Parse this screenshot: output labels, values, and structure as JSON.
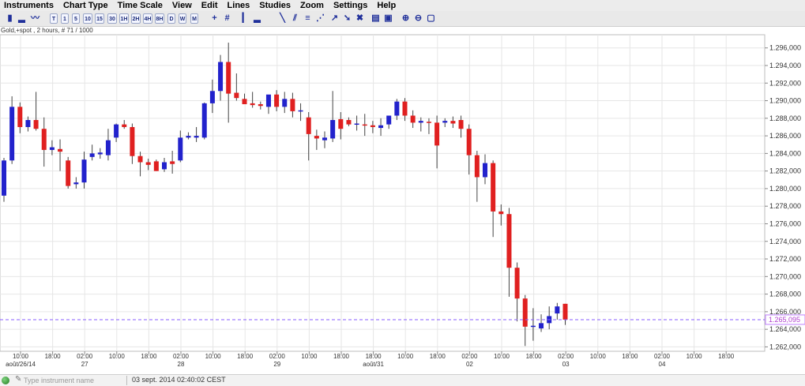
{
  "menu": [
    "Instruments",
    "Chart Type",
    "Time Scale",
    "View",
    "Edit",
    "Lines",
    "Studies",
    "Zoom",
    "Settings",
    "Help"
  ],
  "toolbar": {
    "timeframes": [
      "T",
      "1",
      "5",
      "10",
      "15",
      "30",
      "1H",
      "2H",
      "4H",
      "8H",
      "D",
      "W",
      "M"
    ],
    "selected_timeframe": "2H",
    "icons": [
      "crosshair-icon",
      "grid-icon",
      "candlestick-icon",
      "line-chart-icon",
      "vertical-line-icon",
      "bar-study-icon",
      "trend-line-icon",
      "parallel-line-icon",
      "fibonacci-icon",
      "channel-icon",
      "arrow-tool-icon",
      "pointer-tool-icon",
      "delete-tool-icon",
      "print-icon",
      "save-icon",
      "zoom-in-icon",
      "zoom-out-icon",
      "zoom-reset-icon"
    ]
  },
  "info": "Gold,+spot , 2 hours, # 71 / 1000",
  "status": {
    "search_placeholder": "Type instrument name",
    "datetime": "03 sept. 2014 02:40:02 CEST"
  },
  "chart_data": {
    "type": "candlestick",
    "ylim": [
      1261500,
      1297500
    ],
    "yticks": [
      "1.262,000",
      "1.264,000",
      "1.266,000",
      "1.268,000",
      "1.270,000",
      "1.272,000",
      "1.274,000",
      "1.276,000",
      "1.278,000",
      "1.280,000",
      "1.282,000",
      "1.284,000",
      "1.286,000",
      "1.288,000",
      "1.290,000",
      "1.292,000",
      "1.294,000",
      "1.296,000"
    ],
    "ytick_values": [
      1262000,
      1264000,
      1266000,
      1268000,
      1270000,
      1272000,
      1274000,
      1276000,
      1278000,
      1280000,
      1282000,
      1284000,
      1286000,
      1288000,
      1290000,
      1292000,
      1294000,
      1296000
    ],
    "last_price_label": "1.265,095",
    "last_price": 1265095,
    "up_color": "#2222cc",
    "down_color": "#e02020",
    "grid": true,
    "xticks": [
      {
        "time": "10:00",
        "date": "août/26/14"
      },
      {
        "time": "18:00",
        "date": ""
      },
      {
        "time": "02:00",
        "date": "27"
      },
      {
        "time": "10:00",
        "date": ""
      },
      {
        "time": "18:00",
        "date": ""
      },
      {
        "time": "02:00",
        "date": "28"
      },
      {
        "time": "10:00",
        "date": ""
      },
      {
        "time": "18:00",
        "date": ""
      },
      {
        "time": "02:00",
        "date": "29"
      },
      {
        "time": "10:00",
        "date": ""
      },
      {
        "time": "18:00",
        "date": ""
      },
      {
        "time": "18:00",
        "date": "août/31"
      },
      {
        "time": "10:00",
        "date": ""
      },
      {
        "time": "18:00",
        "date": ""
      },
      {
        "time": "02:00",
        "date": "02"
      },
      {
        "time": "10:00",
        "date": ""
      },
      {
        "time": "18:00",
        "date": ""
      },
      {
        "time": "02:00",
        "date": "03"
      },
      {
        "time": "10:00",
        "date": ""
      },
      {
        "time": "18:00",
        "date": ""
      },
      {
        "time": "02:00",
        "date": "04"
      },
      {
        "time": "10:00",
        "date": ""
      },
      {
        "time": "18:00",
        "date": ""
      }
    ],
    "candles": [
      {
        "o": 1279200,
        "h": 1283500,
        "l": 1278500,
        "c": 1283200
      },
      {
        "o": 1283200,
        "h": 1290500,
        "l": 1282800,
        "c": 1289300
      },
      {
        "o": 1289300,
        "h": 1289800,
        "l": 1286300,
        "c": 1287000
      },
      {
        "o": 1287000,
        "h": 1288200,
        "l": 1286500,
        "c": 1287800
      },
      {
        "o": 1287800,
        "h": 1291000,
        "l": 1286600,
        "c": 1286800
      },
      {
        "o": 1286800,
        "h": 1288100,
        "l": 1282500,
        "c": 1284400
      },
      {
        "o": 1284400,
        "h": 1285500,
        "l": 1283800,
        "c": 1284700
      },
      {
        "o": 1284500,
        "h": 1285600,
        "l": 1282000,
        "c": 1284200
      },
      {
        "o": 1283200,
        "h": 1283600,
        "l": 1280000,
        "c": 1280300
      },
      {
        "o": 1280500,
        "h": 1281300,
        "l": 1280000,
        "c": 1280700
      },
      {
        "o": 1280700,
        "h": 1284200,
        "l": 1280000,
        "c": 1283300
      },
      {
        "o": 1283600,
        "h": 1285000,
        "l": 1283200,
        "c": 1284000
      },
      {
        "o": 1283900,
        "h": 1284600,
        "l": 1283400,
        "c": 1284100
      },
      {
        "o": 1283800,
        "h": 1286800,
        "l": 1283200,
        "c": 1285500
      },
      {
        "o": 1285800,
        "h": 1287400,
        "l": 1285300,
        "c": 1287300
      },
      {
        "o": 1287300,
        "h": 1287800,
        "l": 1286800,
        "c": 1287000
      },
      {
        "o": 1287000,
        "h": 1287400,
        "l": 1282800,
        "c": 1283700
      },
      {
        "o": 1283700,
        "h": 1284200,
        "l": 1281400,
        "c": 1283000
      },
      {
        "o": 1283000,
        "h": 1283400,
        "l": 1282100,
        "c": 1282700
      },
      {
        "o": 1283100,
        "h": 1283300,
        "l": 1282000,
        "c": 1282000
      },
      {
        "o": 1282200,
        "h": 1283500,
        "l": 1281900,
        "c": 1283000
      },
      {
        "o": 1283100,
        "h": 1284300,
        "l": 1281700,
        "c": 1282800
      },
      {
        "o": 1283200,
        "h": 1286600,
        "l": 1283000,
        "c": 1285800
      },
      {
        "o": 1285800,
        "h": 1286400,
        "l": 1285600,
        "c": 1286000
      },
      {
        "o": 1285800,
        "h": 1287000,
        "l": 1285300,
        "c": 1286000
      },
      {
        "o": 1285800,
        "h": 1289800,
        "l": 1285600,
        "c": 1289700
      },
      {
        "o": 1289700,
        "h": 1292400,
        "l": 1288600,
        "c": 1291100
      },
      {
        "o": 1291100,
        "h": 1295200,
        "l": 1290000,
        "c": 1294400
      },
      {
        "o": 1294400,
        "h": 1296600,
        "l": 1287500,
        "c": 1290800
      },
      {
        "o": 1290900,
        "h": 1293100,
        "l": 1290000,
        "c": 1290300
      },
      {
        "o": 1290200,
        "h": 1290800,
        "l": 1289600,
        "c": 1289600
      },
      {
        "o": 1289700,
        "h": 1291000,
        "l": 1289200,
        "c": 1289500
      },
      {
        "o": 1289600,
        "h": 1289900,
        "l": 1289000,
        "c": 1289400
      },
      {
        "o": 1289300,
        "h": 1290600,
        "l": 1288500,
        "c": 1290700
      },
      {
        "o": 1290700,
        "h": 1291200,
        "l": 1288800,
        "c": 1289300
      },
      {
        "o": 1289300,
        "h": 1291000,
        "l": 1288600,
        "c": 1290200
      },
      {
        "o": 1290200,
        "h": 1290900,
        "l": 1288100,
        "c": 1288800
      },
      {
        "o": 1288800,
        "h": 1289700,
        "l": 1287700,
        "c": 1288900
      },
      {
        "o": 1288100,
        "h": 1288700,
        "l": 1283200,
        "c": 1286200
      },
      {
        "o": 1286000,
        "h": 1286700,
        "l": 1284400,
        "c": 1285700
      },
      {
        "o": 1285500,
        "h": 1286500,
        "l": 1284600,
        "c": 1285800
      },
      {
        "o": 1285700,
        "h": 1291100,
        "l": 1285300,
        "c": 1287800
      },
      {
        "o": 1287900,
        "h": 1288700,
        "l": 1285600,
        "c": 1286800
      },
      {
        "o": 1287800,
        "h": 1288100,
        "l": 1287100,
        "c": 1287300
      },
      {
        "o": 1287400,
        "h": 1288300,
        "l": 1286600,
        "c": 1287400
      },
      {
        "o": 1287300,
        "h": 1288500,
        "l": 1286000,
        "c": 1287200
      },
      {
        "o": 1287200,
        "h": 1287700,
        "l": 1286300,
        "c": 1287000
      },
      {
        "o": 1286900,
        "h": 1288000,
        "l": 1286000,
        "c": 1287200
      },
      {
        "o": 1287300,
        "h": 1288300,
        "l": 1286800,
        "c": 1288300
      },
      {
        "o": 1288300,
        "h": 1290200,
        "l": 1287800,
        "c": 1289900
      },
      {
        "o": 1289900,
        "h": 1290300,
        "l": 1287700,
        "c": 1288300
      },
      {
        "o": 1288300,
        "h": 1288900,
        "l": 1286900,
        "c": 1287500
      },
      {
        "o": 1287500,
        "h": 1288100,
        "l": 1286500,
        "c": 1287700
      },
      {
        "o": 1287600,
        "h": 1288000,
        "l": 1286200,
        "c": 1287500
      },
      {
        "o": 1287500,
        "h": 1288300,
        "l": 1282300,
        "c": 1284900
      },
      {
        "o": 1287500,
        "h": 1288000,
        "l": 1287000,
        "c": 1287700
      },
      {
        "o": 1287700,
        "h": 1288200,
        "l": 1286900,
        "c": 1287400
      },
      {
        "o": 1287800,
        "h": 1288300,
        "l": 1285800,
        "c": 1286800
      },
      {
        "o": 1286800,
        "h": 1287300,
        "l": 1281600,
        "c": 1283800
      },
      {
        "o": 1283800,
        "h": 1284300,
        "l": 1278500,
        "c": 1281300
      },
      {
        "o": 1281300,
        "h": 1283900,
        "l": 1280500,
        "c": 1282900
      },
      {
        "o": 1282900,
        "h": 1283200,
        "l": 1274500,
        "c": 1277400
      },
      {
        "o": 1277400,
        "h": 1278200,
        "l": 1275800,
        "c": 1277100
      },
      {
        "o": 1277100,
        "h": 1277800,
        "l": 1267700,
        "c": 1271000
      },
      {
        "o": 1271000,
        "h": 1271600,
        "l": 1264900,
        "c": 1267500
      },
      {
        "o": 1267500,
        "h": 1267900,
        "l": 1262100,
        "c": 1264300
      },
      {
        "o": 1264300,
        "h": 1266400,
        "l": 1262700,
        "c": 1264400
      },
      {
        "o": 1264100,
        "h": 1265700,
        "l": 1263700,
        "c": 1264700
      },
      {
        "o": 1264700,
        "h": 1266600,
        "l": 1264000,
        "c": 1265500
      },
      {
        "o": 1265800,
        "h": 1267000,
        "l": 1265100,
        "c": 1266600
      },
      {
        "o": 1266900,
        "h": 1266900,
        "l": 1264500,
        "c": 1265100
      }
    ]
  }
}
